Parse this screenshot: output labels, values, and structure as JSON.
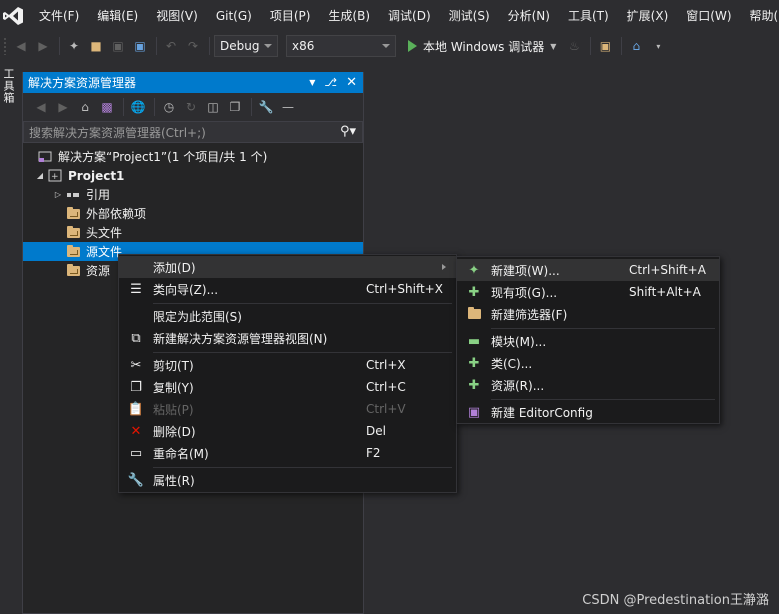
{
  "menubar": {
    "items": [
      "文件(F)",
      "编辑(E)",
      "视图(V)",
      "Git(G)",
      "项目(P)",
      "生成(B)",
      "调试(D)",
      "测试(S)",
      "分析(N)",
      "工具(T)",
      "扩展(X)",
      "窗口(W)",
      "帮助("
    ]
  },
  "toolbar": {
    "config_value": "Debug",
    "platform_value": "x86",
    "run_label": "本地 Windows 调试器"
  },
  "toolbox": {
    "label": "工具箱"
  },
  "solution_explorer": {
    "title": "解决方案资源管理器",
    "search_placeholder": "搜索解决方案资源管理器(Ctrl+;)",
    "tree": {
      "solution": "解决方案“Project1”(1 个项目/共 1 个)",
      "project": "Project1",
      "references": "引用",
      "external_deps": "外部依赖项",
      "headers": "头文件",
      "sources": "源文件",
      "resources": "资源"
    }
  },
  "context_menu": {
    "items": [
      {
        "label": "添加(D)",
        "shortcut": ""
      },
      {
        "label": "类向导(Z)...",
        "shortcut": "Ctrl+Shift+X"
      },
      {
        "label": "限定为此范围(S)",
        "shortcut": ""
      },
      {
        "label": "新建解决方案资源管理器视图(N)",
        "shortcut": ""
      },
      {
        "label": "剪切(T)",
        "shortcut": "Ctrl+X"
      },
      {
        "label": "复制(Y)",
        "shortcut": "Ctrl+C"
      },
      {
        "label": "粘贴(P)",
        "shortcut": "Ctrl+V"
      },
      {
        "label": "删除(D)",
        "shortcut": "Del"
      },
      {
        "label": "重命名(M)",
        "shortcut": "F2"
      },
      {
        "label": "属性(R)",
        "shortcut": ""
      }
    ]
  },
  "submenu": {
    "items": [
      {
        "label": "新建项(W)...",
        "shortcut": "Ctrl+Shift+A"
      },
      {
        "label": "现有项(G)...",
        "shortcut": "Shift+Alt+A"
      },
      {
        "label": "新建筛选器(F)",
        "shortcut": ""
      },
      {
        "label": "模块(M)...",
        "shortcut": ""
      },
      {
        "label": "类(C)...",
        "shortcut": ""
      },
      {
        "label": "资源(R)...",
        "shortcut": ""
      },
      {
        "label": "新建 EditorConfig",
        "shortcut": ""
      }
    ]
  },
  "watermark": "CSDN @Predestination王瀞潞",
  "colors": {
    "accent": "#007acc",
    "background": "#2d2d30",
    "menu_bg": "#1b1b1c",
    "folder": "#dcb67a"
  }
}
